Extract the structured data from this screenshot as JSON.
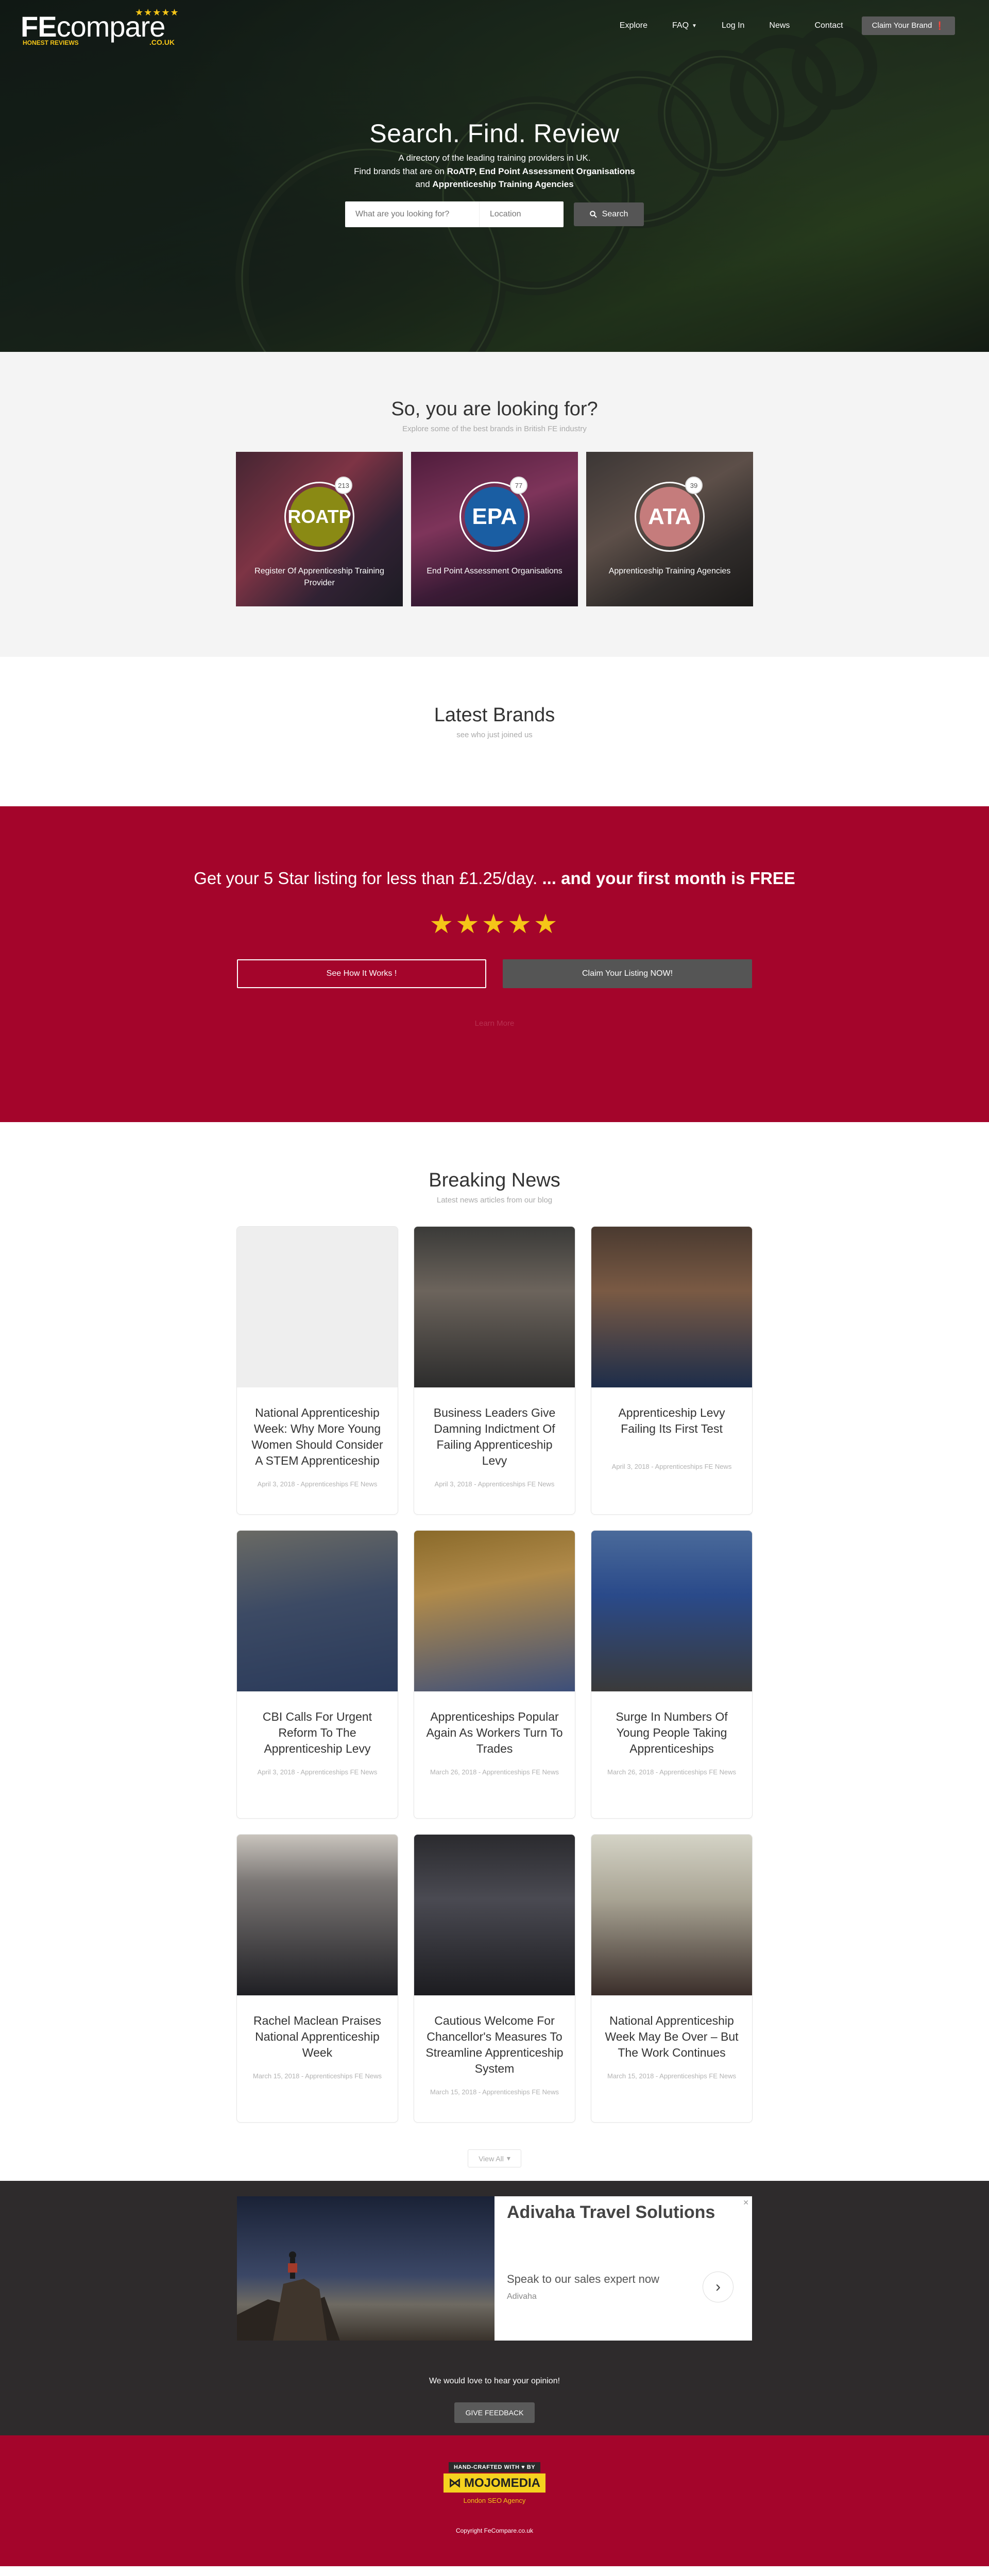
{
  "brand": {
    "logo_fe": "FE",
    "logo_compare": "compare",
    "logo_stars": "★★★★★",
    "logo_sub": "HONEST REVIEWS",
    "logo_couk": ".CO.UK"
  },
  "nav": {
    "items": [
      "Explore",
      "FAQ",
      "Log In",
      "News",
      "Contact"
    ],
    "claim_label": "Claim Your Brand"
  },
  "hero": {
    "title": "Search. Find. Review",
    "line1": "A directory of the leading training providers in UK.",
    "line2_prefix": "Find brands that are on ",
    "line2_bold": "RoATP, End Point Assessment Organisations",
    "line3_prefix": "and ",
    "line3_bold": "Apprenticeship Training Agencies",
    "search_placeholder": "What are you looking for?",
    "location_placeholder": "Location",
    "search_button": "Search"
  },
  "looking": {
    "title": "So, you are looking for?",
    "subtitle": "Explore some of the best brands in British FE industry",
    "categories": [
      {
        "abbr": "ROATP",
        "count": "213",
        "label": "Register Of Apprenticeship Training Provider"
      },
      {
        "abbr": "EPA",
        "count": "77",
        "label": "End Point Assessment Organisations"
      },
      {
        "abbr": "ATA",
        "count": "39",
        "label": "Apprenticeship Training Agencies"
      }
    ]
  },
  "brands": {
    "title": "Latest Brands",
    "subtitle": "see who just joined us"
  },
  "cta": {
    "title_part1": "Get your 5 Star listing for less than £1.25/day. ",
    "title_part2": "... and your first month is FREE",
    "stars": "★★★★★",
    "how_button": "See How It Works !",
    "claim_button": "Claim Your Listing NOW!",
    "faint_text": "Learn More"
  },
  "news": {
    "title": "Breaking News",
    "subtitle": "Latest news articles from our blog",
    "articles": [
      {
        "title": "National Apprenticeship Week: Why More Young Women Should Consider A STEM Apprenticeship",
        "meta": "April 3, 2018 - Apprenticeships FE News"
      },
      {
        "title": "Business Leaders Give Damning Indictment Of Failing Apprenticeship Levy",
        "meta": "April 3, 2018 - Apprenticeships FE News"
      },
      {
        "title": "Apprenticeship Levy Failing Its First Test",
        "meta": "April 3, 2018 - Apprenticeships FE News"
      },
      {
        "title": "CBI Calls For Urgent Reform To The Apprenticeship Levy",
        "meta": "April 3, 2018 - Apprenticeships FE News"
      },
      {
        "title": "Apprenticeships Popular Again As Workers Turn To Trades",
        "meta": "March 26, 2018 - Apprenticeships FE News"
      },
      {
        "title": "Surge In Numbers Of Young People Taking Apprenticeships",
        "meta": "March 26, 2018 - Apprenticeships FE News"
      },
      {
        "title": "Rachel Maclean Praises National Apprenticeship Week",
        "meta": "March 15, 2018 - Apprenticeships FE News"
      },
      {
        "title": "Cautious Welcome For Chancellor's Measures To Streamline Apprenticeship System",
        "meta": "March 15, 2018 - Apprenticeships FE News"
      },
      {
        "title": "National Apprenticeship Week May Be Over – But The Work Continues",
        "meta": "March 15, 2018 - Apprenticeships FE News"
      }
    ],
    "view_all": "View All"
  },
  "ad": {
    "title": "Adivaha Travel Solutions",
    "text": "Speak to our sales expert now",
    "brand": "Adivaha"
  },
  "feedback": {
    "text": "We would love to hear your opinion!",
    "button": "GIVE FEEDBACK"
  },
  "footer": {
    "handcrafted": "HAND-CRAFTED WITH ♥ BY",
    "mojo": "MOJOMEDIA",
    "agency": "London SEO Agency",
    "copyright": "Copyright FeCompare.co.uk"
  }
}
